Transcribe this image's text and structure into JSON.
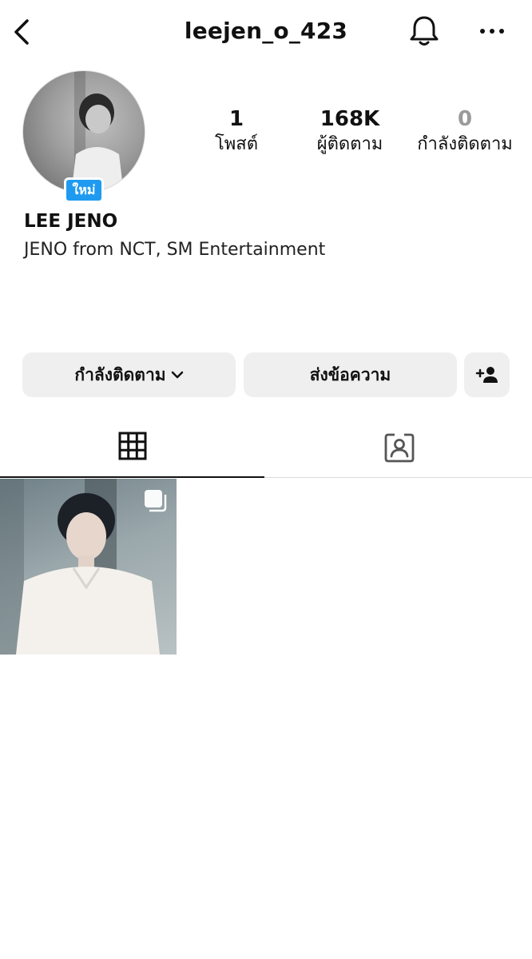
{
  "header": {
    "username": "leejen_o_423",
    "back_icon": "chevron-left-icon",
    "bell_icon": "bell-icon",
    "more_icon": "more-horizontal-icon"
  },
  "profile": {
    "new_badge": "ใหม่",
    "display_name": "LEE JENO",
    "bio": "JENO from NCT, SM Entertainment",
    "stats": {
      "posts": {
        "value": "1",
        "label": "โพสต์"
      },
      "followers": {
        "value": "168K",
        "label": "ผู้ติดตาม"
      },
      "following": {
        "value": "0",
        "label": "กำลังติดตาม"
      }
    }
  },
  "actions": {
    "following_label": "กำลังติดตาม",
    "message_label": "ส่งข้อความ",
    "add_user_icon": "person-add-icon"
  },
  "tabs": {
    "grid_icon": "grid-icon",
    "tagged_icon": "tagged-person-icon",
    "active": "grid"
  },
  "colors": {
    "badge_blue": "#1e9bf0",
    "button_bg": "#efefef",
    "muted_text": "#9a9a9a"
  }
}
